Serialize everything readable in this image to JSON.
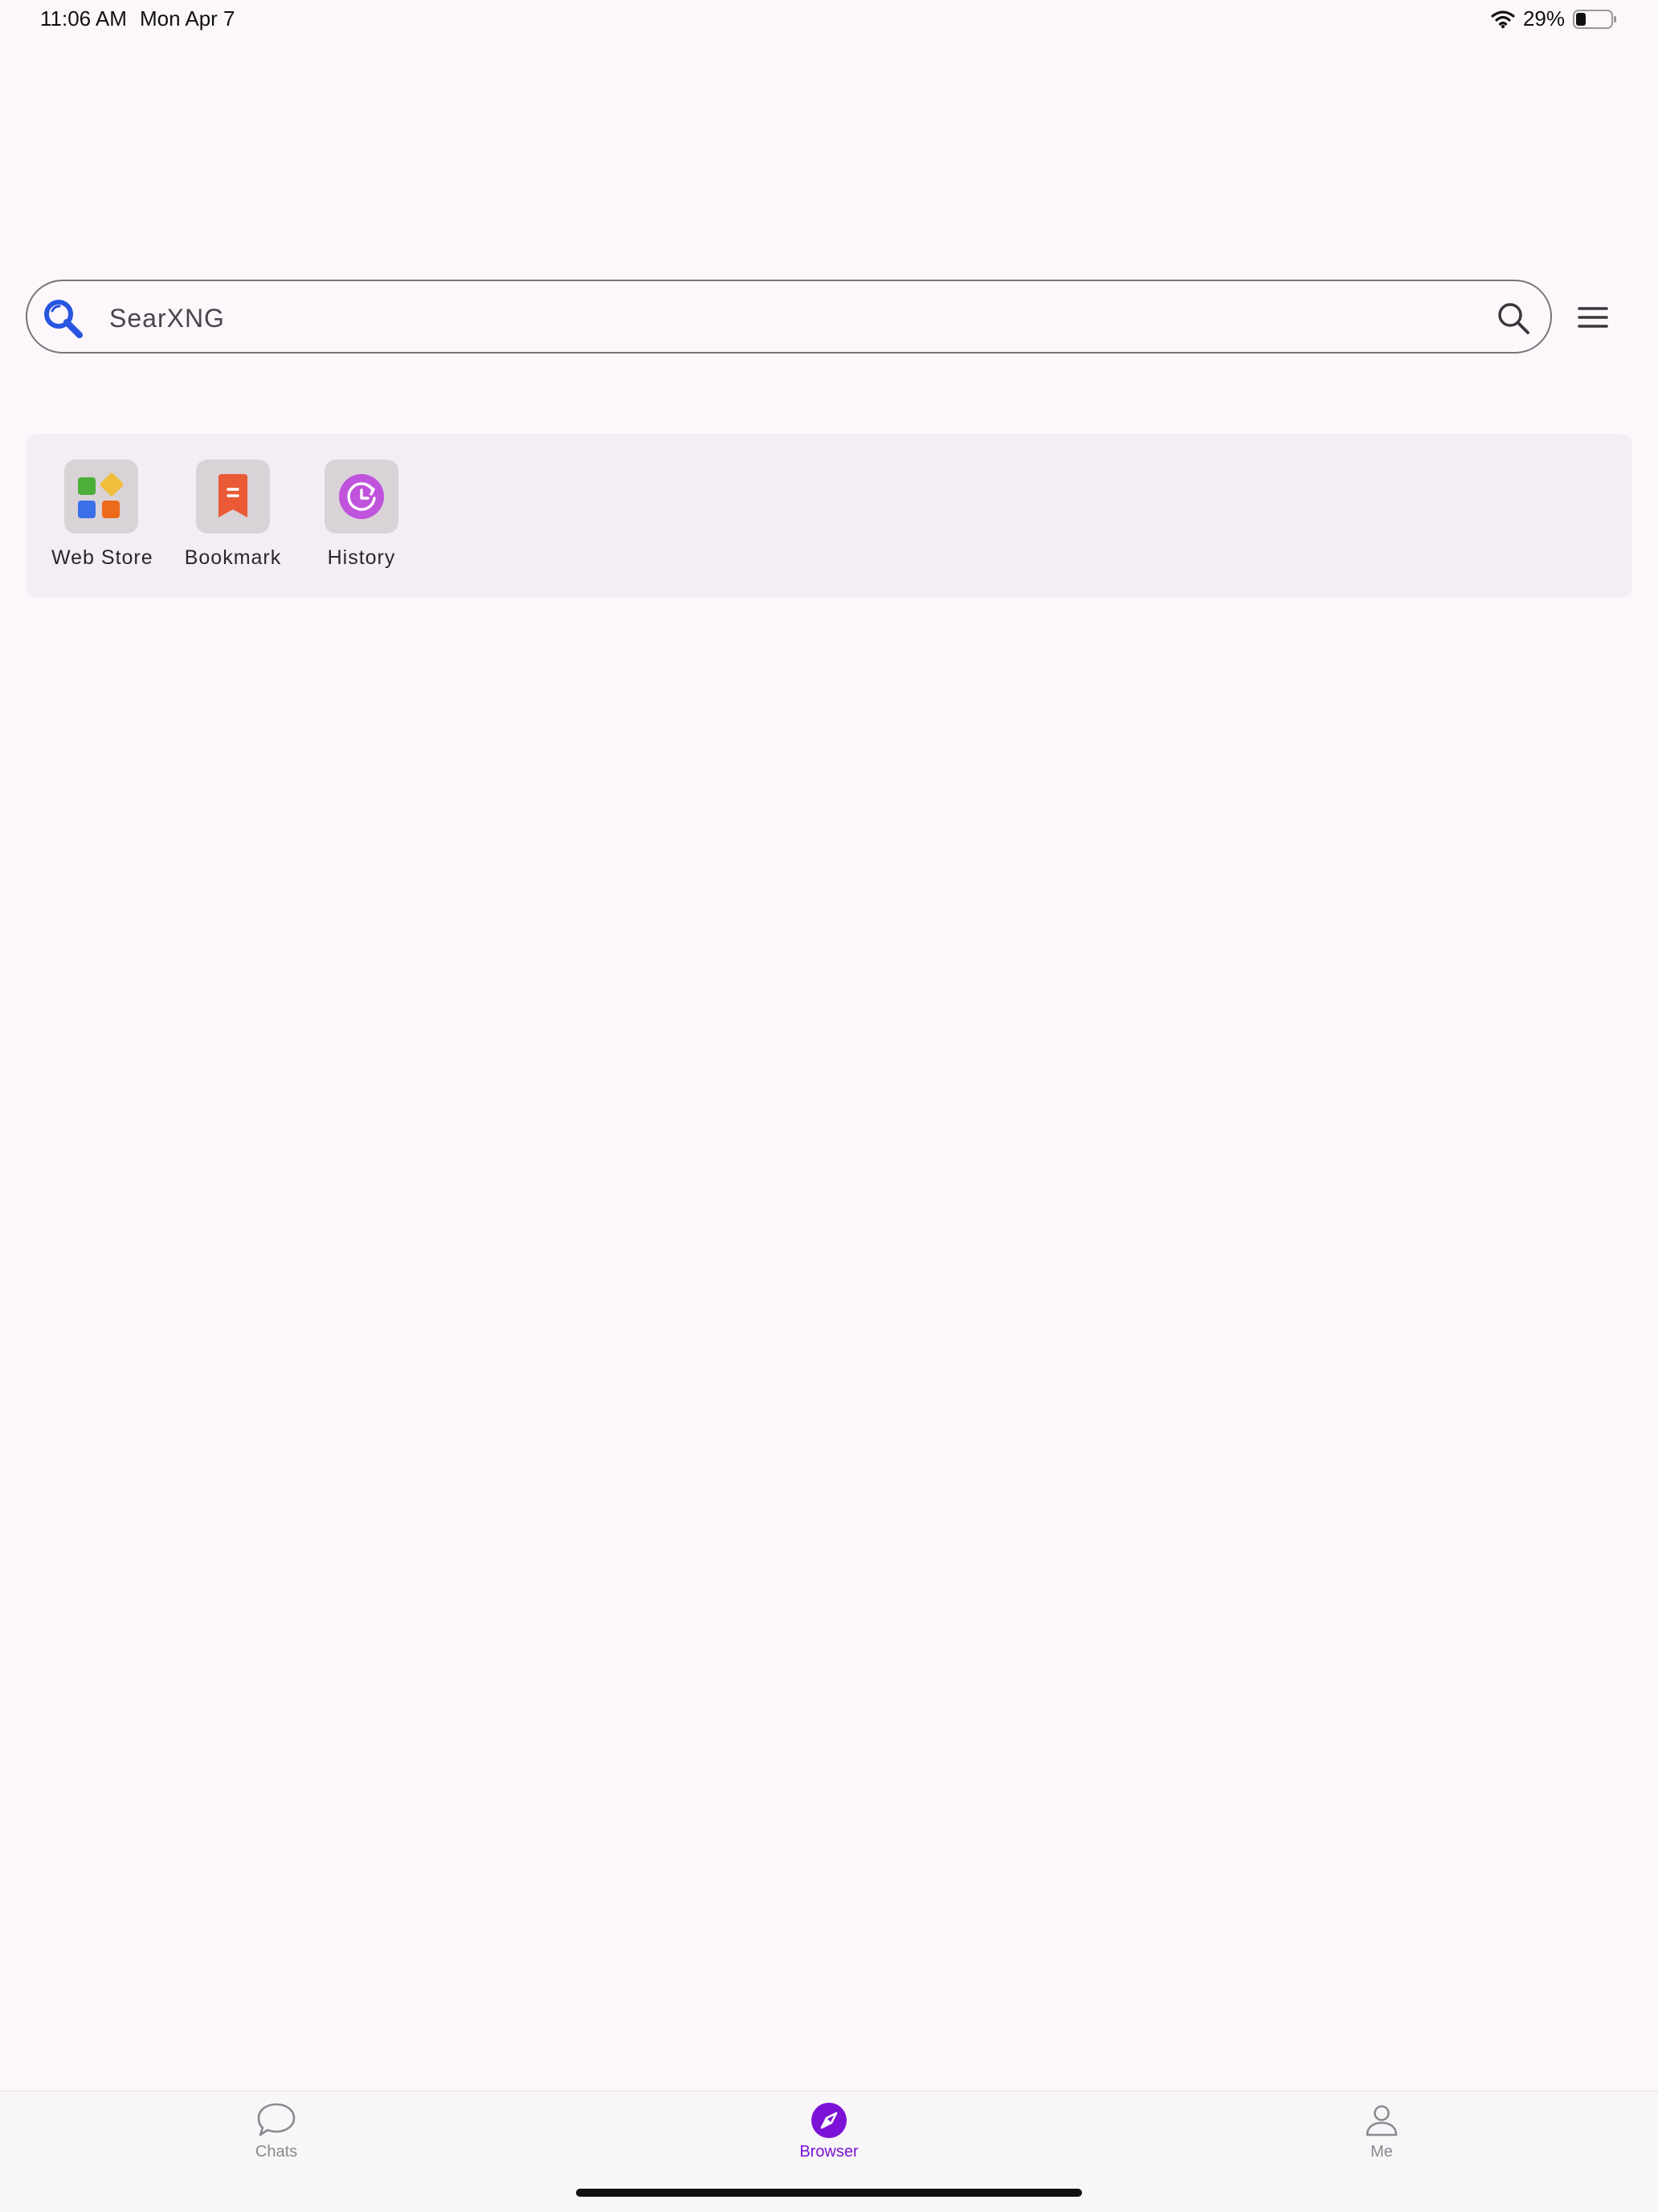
{
  "status_bar": {
    "time": "11:06 AM",
    "date": "Mon Apr 7",
    "battery_percent": "29%",
    "battery_level": 0.29,
    "wifi_icon": "wifi-icon",
    "battery_icon": "battery-icon"
  },
  "search": {
    "engine_icon": "search-engine-icon",
    "placeholder": "SearXNG",
    "value": "",
    "submit_icon": "search-icon",
    "menu_icon": "hamburger-menu-icon"
  },
  "quick_access": {
    "items": [
      {
        "label": "Web Store",
        "icon": "web-store-icon"
      },
      {
        "label": "Bookmark",
        "icon": "bookmark-icon"
      },
      {
        "label": "History",
        "icon": "history-icon"
      }
    ]
  },
  "bottom_nav": {
    "items": [
      {
        "label": "Chats",
        "icon": "chat-bubble-icon",
        "active": false
      },
      {
        "label": "Browser",
        "icon": "compass-icon",
        "active": true
      },
      {
        "label": "Me",
        "icon": "person-icon",
        "active": false
      }
    ],
    "active_color": "#7b12d6",
    "inactive_color": "#8a8a8e"
  }
}
